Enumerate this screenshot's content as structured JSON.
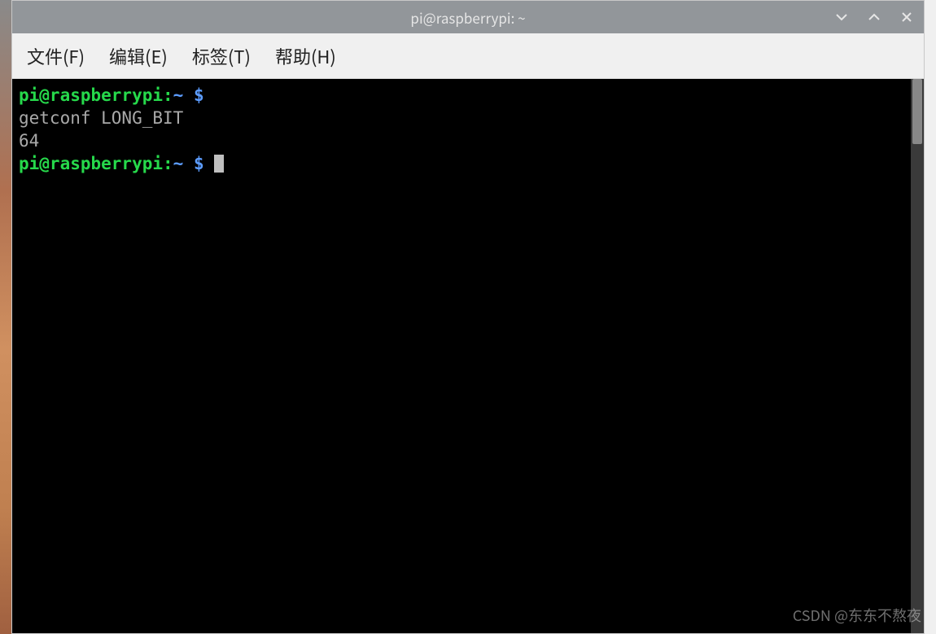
{
  "window": {
    "title": "pi@raspberrypi: ~"
  },
  "menubar": {
    "file": "文件(F)",
    "edit": "编辑(E)",
    "tabs": "标签(T)",
    "help": "帮助(H)"
  },
  "prompt": {
    "userhost": "pi@raspberrypi",
    "colon": ":",
    "path": "~",
    "symbol": "$"
  },
  "terminal": {
    "lines": [
      {
        "type": "prompt",
        "cmd": ""
      },
      {
        "type": "output",
        "text": "getconf LONG_BIT"
      },
      {
        "type": "output",
        "text": "64"
      },
      {
        "type": "prompt",
        "cmd": "",
        "cursor": true
      }
    ]
  },
  "watermark": "CSDN @东东不熬夜",
  "colors": {
    "titlebar_bg": "#92969a",
    "menubar_bg": "#f0f0f0",
    "terminal_bg": "#000000",
    "prompt_user": "#26d94b",
    "prompt_path": "#5c9cff",
    "output_text": "#a9a9a9"
  }
}
